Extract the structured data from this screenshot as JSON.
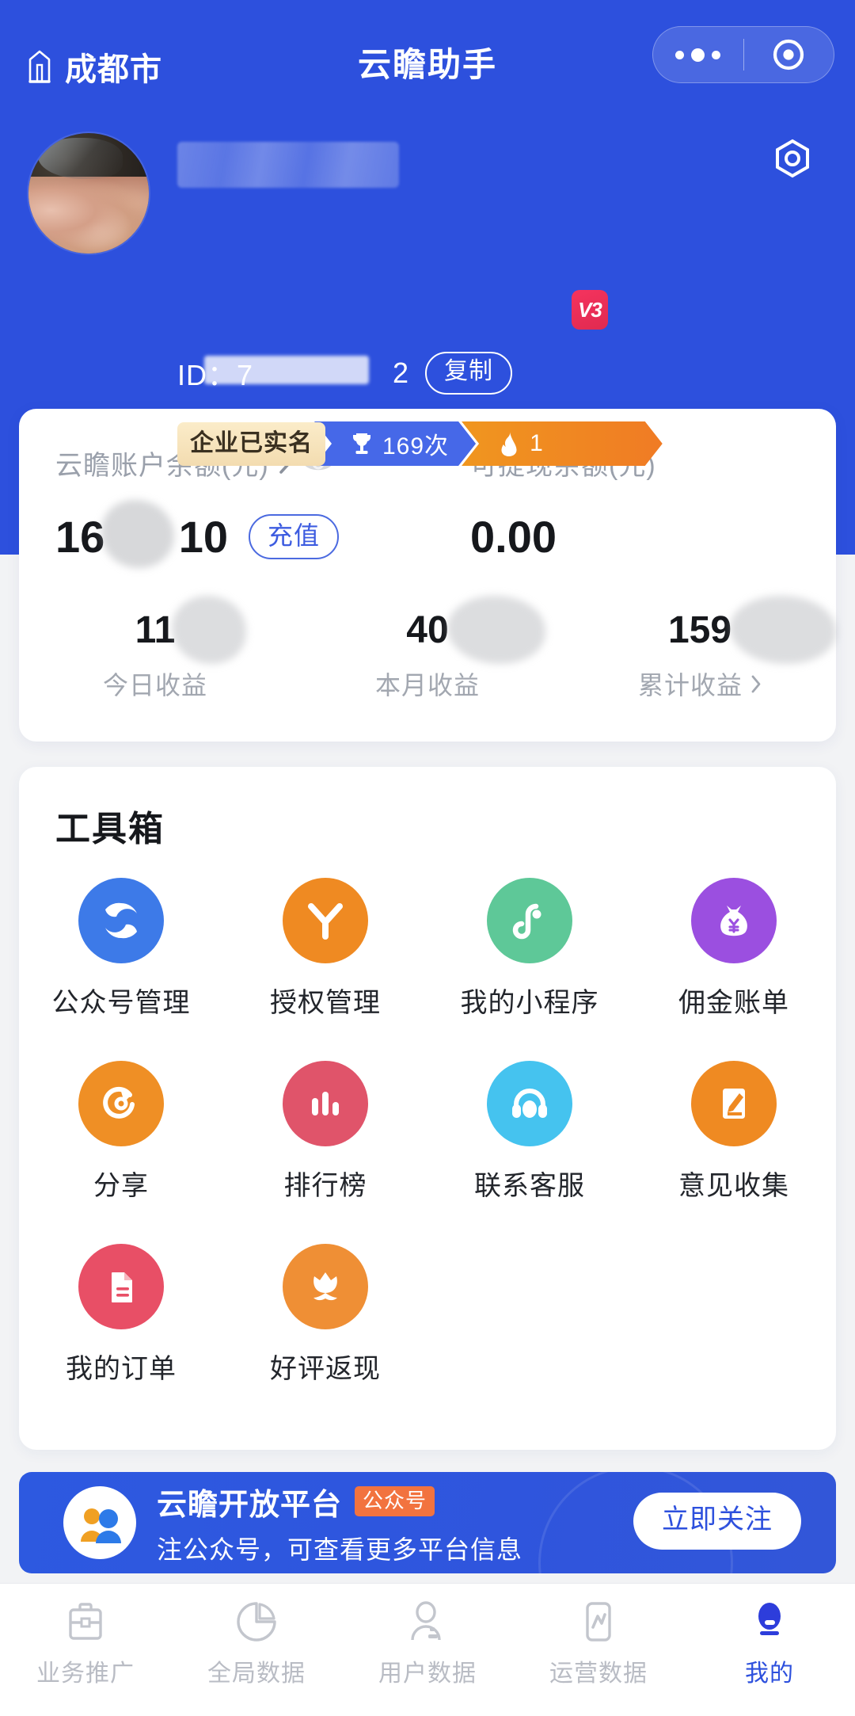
{
  "navbar": {
    "location": "成都市",
    "location_icon": "city-building-icon",
    "title": "云瞻助手",
    "capsule": {
      "more_icon": "more-dots-icon",
      "target_icon": "target-circle-icon"
    }
  },
  "profile": {
    "avatar_alt": "user-avatar",
    "nickname_redacted": "",
    "level_badge": "V3",
    "id_label": "ID：7",
    "id_suffix": "2",
    "copy_button": "复制",
    "settings_icon": "hex-gear-icon",
    "badges": {
      "verified": "企业已实名",
      "trophy_icon": "trophy-icon",
      "trophy_count": "169次",
      "flame_icon": "flame-icon",
      "flame_count": "1"
    }
  },
  "balance_card": {
    "account": {
      "label": "云瞻账户余额(元)",
      "chevron_icon": "chevron-right-icon",
      "eye_icon": "eye-visibility-icon",
      "value_prefix": "16",
      "value_suffix": "10",
      "recharge_button": "充值"
    },
    "withdrawable": {
      "label": "可提现余额(元)",
      "value": "0.00"
    },
    "stats": [
      {
        "value": "11",
        "label": "今日收益",
        "has_chevron": false
      },
      {
        "value": "40",
        "label": "本月收益",
        "has_chevron": false
      },
      {
        "value": "159",
        "label": "累计收益",
        "has_chevron": true
      }
    ]
  },
  "toolbox": {
    "title": "工具箱",
    "items": [
      {
        "label": "公众号管理",
        "icon": "official-account-icon",
        "color": "#3d7ae8"
      },
      {
        "label": "授权管理",
        "icon": "authorize-y-icon",
        "color": "#ef8a22"
      },
      {
        "label": "我的小程序",
        "icon": "miniprogram-icon",
        "color": "#5ec898"
      },
      {
        "label": "佣金账单",
        "icon": "money-bag-icon",
        "color": "#9b4fe0"
      },
      {
        "label": "分享",
        "icon": "share-refresh-icon",
        "color": "#ef8f25"
      },
      {
        "label": "排行榜",
        "icon": "rank-bars-icon",
        "color": "#e0546a"
      },
      {
        "label": "联系客服",
        "icon": "headset-support-icon",
        "color": "#45c3ef"
      },
      {
        "label": "意见收集",
        "icon": "feedback-pen-icon",
        "color": "#ef8a22"
      },
      {
        "label": "我的订单",
        "icon": "order-document-icon",
        "color": "#e84f66"
      },
      {
        "label": "好评返现",
        "icon": "flower-cashback-icon",
        "color": "#ef8f35"
      }
    ]
  },
  "promo": {
    "logo_icon": "people-group-icon",
    "title": "云瞻开放平台",
    "tag": "公众号",
    "subtitle": "注公众号，可查看更多平台信息",
    "cta": "立即关注"
  },
  "tabbar": {
    "items": [
      {
        "label": "业务推广",
        "icon": "briefcase-icon",
        "active": false
      },
      {
        "label": "全局数据",
        "icon": "pie-chart-icon",
        "active": false
      },
      {
        "label": "用户数据",
        "icon": "user-person-icon",
        "active": false
      },
      {
        "label": "运营数据",
        "icon": "line-chart-phone-icon",
        "active": false
      },
      {
        "label": "我的",
        "icon": "profile-person-icon",
        "active": true
      }
    ]
  },
  "colors": {
    "brand_blue": "#2d50dd",
    "accent_orange": "#ef8a22",
    "page_bg": "#f2f3f5"
  }
}
